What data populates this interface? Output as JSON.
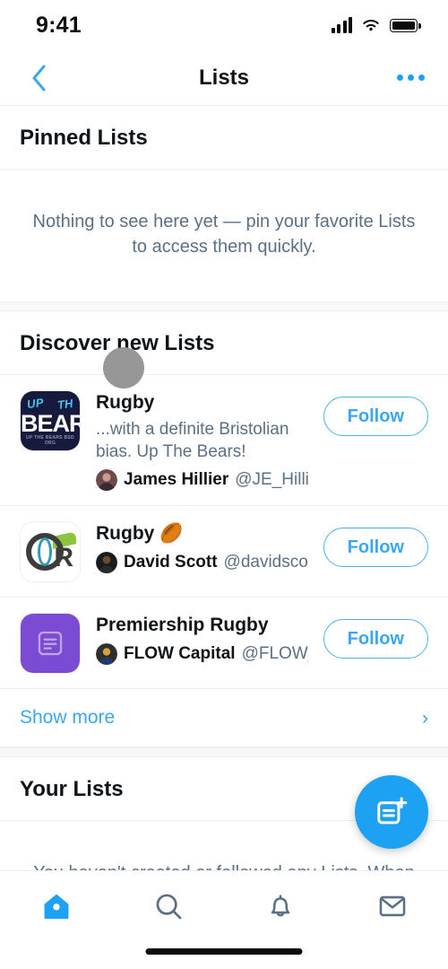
{
  "status_bar": {
    "time": "9:41",
    "signal_icon": "cellular-signal-icon",
    "wifi_icon": "wifi-icon",
    "battery_icon": "battery-full-icon"
  },
  "navbar": {
    "back_icon": "chevron-left-icon",
    "title": "Lists",
    "more_icon": "more-horizontal-icon"
  },
  "pinned": {
    "heading": "Pinned Lists",
    "empty_text": "Nothing to see here yet — pin your favorite Lists to access them quickly."
  },
  "discover": {
    "heading": "Discover new Lists",
    "show_more_label": "Show more",
    "show_more_chevron": "chevron-right-icon",
    "items": [
      {
        "title": "Rugby",
        "description": "...with a definite Bristolian bias. Up The Bears!",
        "author_name": "James Hillier",
        "author_handle": "@JE_Hillier",
        "follow_label": "Follow",
        "thumb": "up-the-bears-logo"
      },
      {
        "title": "Rugby 🏉",
        "description": "",
        "author_name": "David Scott",
        "author_handle": "@davidsco...",
        "follow_label": "Follow",
        "thumb": "qr-logo"
      },
      {
        "title": "Premiership Rugby",
        "description": "",
        "author_name": "FLOW Capital",
        "author_handle": "@FLOW_...",
        "follow_label": "Follow",
        "thumb": "purple-list-placeholder"
      }
    ]
  },
  "your_lists": {
    "heading": "Your Lists",
    "empty_text": "You haven't created or followed any Lists. When you do, they'll show up here."
  },
  "fab": {
    "icon": "new-list-icon",
    "color": "#1da1f2"
  },
  "tabbar": {
    "items": [
      {
        "icon": "home-icon",
        "active": true
      },
      {
        "icon": "search-icon",
        "active": false
      },
      {
        "icon": "bell-icon",
        "active": false
      },
      {
        "icon": "envelope-icon",
        "active": false
      }
    ],
    "active_color": "#1da1f2",
    "inactive_color": "#5b7083"
  },
  "overlay": {
    "touch_indicator": "touch-point-indicator"
  },
  "theme": {
    "accent": "#1da1f2",
    "text": "#0f1419",
    "muted": "#5b7083",
    "divider": "#eceef0"
  }
}
